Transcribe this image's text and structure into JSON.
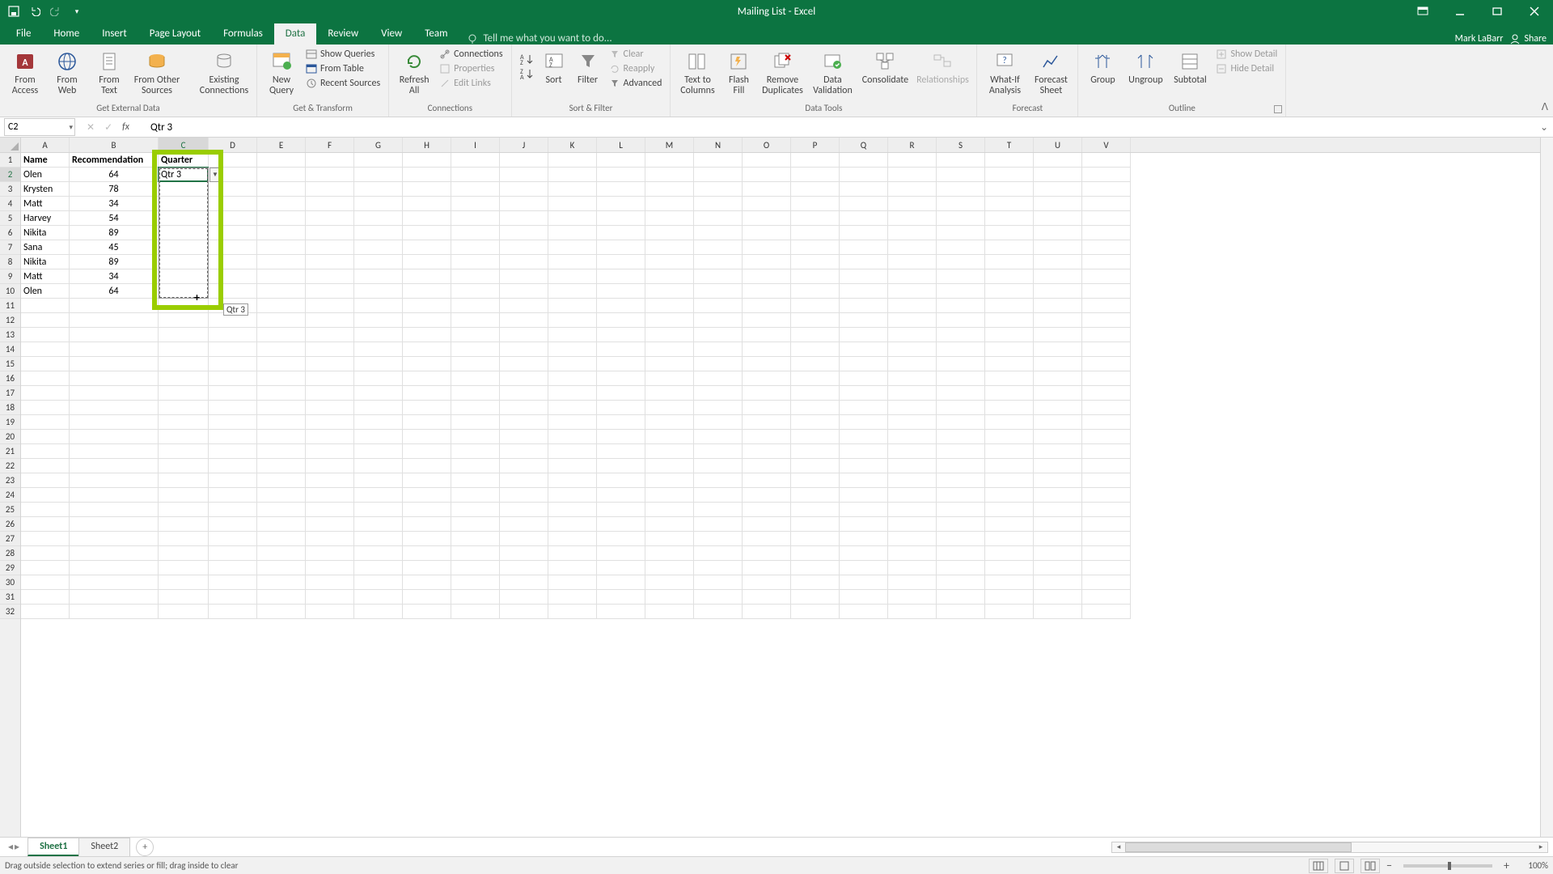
{
  "title": "Mailing List - Excel",
  "user": "Mark LaBarr",
  "share_label": "Share",
  "tellme_placeholder": "Tell me what you want to do...",
  "tabs": [
    "File",
    "Home",
    "Insert",
    "Page Layout",
    "Formulas",
    "Data",
    "Review",
    "View",
    "Team"
  ],
  "active_tab": "Data",
  "namebox": "C2",
  "formula": "Qtr 3",
  "ribbon": {
    "ext": {
      "from_access": "From\nAccess",
      "from_web": "From\nWeb",
      "from_text": "From\nText",
      "from_other": "From Other\nSources",
      "existing": "Existing\nConnections",
      "label": "Get External Data"
    },
    "gt": {
      "new_query": "New\nQuery",
      "show_queries": "Show Queries",
      "from_table": "From Table",
      "recent": "Recent Sources",
      "label": "Get & Transform"
    },
    "conn": {
      "refresh": "Refresh\nAll",
      "connections": "Connections",
      "properties": "Properties",
      "edit_links": "Edit Links",
      "label": "Connections"
    },
    "sortfilter": {
      "sort": "Sort",
      "filter": "Filter",
      "clear": "Clear",
      "reapply": "Reapply",
      "advanced": "Advanced",
      "label": "Sort & Filter"
    },
    "datatools": {
      "ttc": "Text to\nColumns",
      "flash": "Flash\nFill",
      "remdup": "Remove\nDuplicates",
      "dval": "Data\nValidation",
      "consolidate": "Consolidate",
      "relationships": "Relationships",
      "label": "Data Tools"
    },
    "forecast": {
      "whatif": "What-If\nAnalysis",
      "fsheet": "Forecast\nSheet",
      "label": "Forecast"
    },
    "outline": {
      "group": "Group",
      "ungroup": "Ungroup",
      "subtotal": "Subtotal",
      "showdetail": "Show Detail",
      "hidedetail": "Hide Detail",
      "label": "Outline"
    }
  },
  "columns": [
    "A",
    "B",
    "C",
    "D",
    "E",
    "F",
    "G",
    "H",
    "I",
    "J",
    "K",
    "L",
    "M",
    "N",
    "O",
    "P",
    "Q",
    "R",
    "S",
    "T",
    "U",
    "V"
  ],
  "col_widths": {
    "A": 60,
    "B": 110,
    "C": 62,
    "default": 60
  },
  "headers": {
    "A": "Name",
    "B": "Recommendation",
    "C": "Quarter"
  },
  "rows": [
    {
      "n": 2,
      "A": "Olen",
      "B": "64",
      "C": "Qtr 3"
    },
    {
      "n": 3,
      "A": "Krysten",
      "B": "78",
      "C": ""
    },
    {
      "n": 4,
      "A": "Matt",
      "B": "34",
      "C": ""
    },
    {
      "n": 5,
      "A": "Harvey",
      "B": "54",
      "C": ""
    },
    {
      "n": 6,
      "A": "Nikita",
      "B": "89",
      "C": ""
    },
    {
      "n": 7,
      "A": "Sana",
      "B": "45",
      "C": ""
    },
    {
      "n": 8,
      "A": "Nikita",
      "B": "89",
      "C": ""
    },
    {
      "n": 9,
      "A": "Matt",
      "B": "34",
      "C": ""
    },
    {
      "n": 10,
      "A": "Olen",
      "B": "64",
      "C": ""
    }
  ],
  "max_row": 32,
  "fill_tooltip": "Qtr 3",
  "sheets": [
    "Sheet1",
    "Sheet2"
  ],
  "active_sheet": "Sheet1",
  "status_text": "Drag outside selection to extend series or fill; drag inside to clear",
  "zoom": "100%"
}
